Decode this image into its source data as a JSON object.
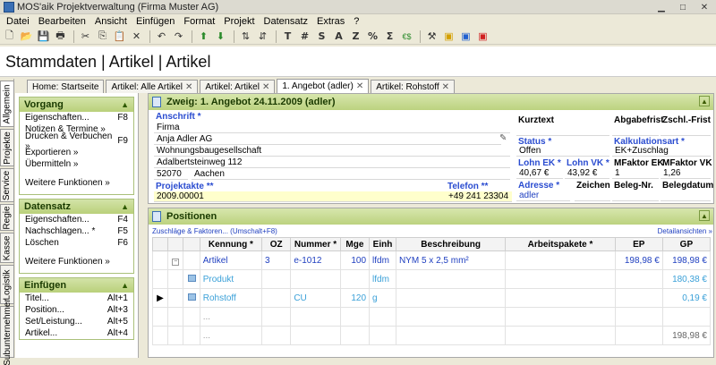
{
  "window": {
    "title": "MOS'aik Projektverwaltung (Firma Muster AG)",
    "controls": [
      "minimize",
      "maximize",
      "close"
    ]
  },
  "menu": [
    "Datei",
    "Bearbeiten",
    "Ansicht",
    "Einfügen",
    "Format",
    "Projekt",
    "Datensatz",
    "Extras",
    "?"
  ],
  "toolbar": {
    "new": "🗋",
    "open": "📂",
    "save": "💾",
    "print": "🖶",
    "cut": "✂",
    "copy": "⎘",
    "paste": "📋",
    "delete": "✕",
    "undo": "↶",
    "redo": "↷",
    "up": "⬆",
    "down": "⬇",
    "t": "T",
    "hash": "#",
    "s": "S",
    "a": "A",
    "z": "Z",
    "percent": "%",
    "sum": "Σ",
    "euro": "€$"
  },
  "page_title": "Stammdaten | Artikel | Artikel",
  "tabs": [
    {
      "label": "Home: Startseite",
      "close": false
    },
    {
      "label": "Artikel: Alle Artikel",
      "close": true
    },
    {
      "label": "Artikel: Artikel",
      "close": true
    },
    {
      "label": "1. Angebot (adler)",
      "close": true,
      "active": true
    },
    {
      "label": "Artikel: Rohstoff",
      "close": true
    }
  ],
  "close_glyph": "✕",
  "vertical_tabs": [
    "Allgemein",
    "Projekte",
    "Service",
    "Regie",
    "Kasse",
    "Logistik",
    "Subunternehmer"
  ],
  "sidebar": {
    "vorgang": {
      "title": "Vorgang",
      "items": [
        {
          "label": "Eigenschaften...",
          "key": "F8"
        },
        {
          "label": "Notizen & Termine »",
          "key": ""
        },
        {
          "label": "Drucken & Verbuchen »",
          "key": "F9"
        },
        {
          "label": "Exportieren »",
          "key": ""
        },
        {
          "label": "Übermitteln »",
          "key": ""
        }
      ],
      "more": "Weitere Funktionen »"
    },
    "datensatz": {
      "title": "Datensatz",
      "items": [
        {
          "label": "Eigenschaften...",
          "key": "F4"
        },
        {
          "label": "Nachschlagen... *",
          "key": "F5"
        },
        {
          "label": "Löschen",
          "key": "F6"
        }
      ],
      "more": "Weitere Funktionen »"
    },
    "einfuegen": {
      "title": "Einfügen",
      "items": [
        {
          "label": "Titel...",
          "key": "Alt+1"
        },
        {
          "label": "Position...",
          "key": "Alt+3"
        },
        {
          "label": "Set/Leistung...",
          "key": "Alt+5"
        },
        {
          "label": "Artikel...",
          "key": "Alt+4"
        }
      ]
    }
  },
  "header_box": {
    "title": "Zweig: 1. Angebot 24.11.2009 (adler)",
    "anschrift_label": "Anschrift *",
    "anschrift_lines": [
      "Firma",
      "Anja Adler AG",
      "Wohnungsbaugesellschaft",
      "Adalbertsteinweg 112"
    ],
    "plz": "52070",
    "ort": "Aachen",
    "projektakte_label": "Projektakte **",
    "projektakte": "2009.00001",
    "telefon_label": "Telefon **",
    "telefon": "+49 241 23304",
    "kurztext_label": "Kurztext",
    "status_label": "Status *",
    "status": "Offen",
    "lohn_ek_label": "Lohn EK *",
    "lohn_ek": "40,67 €",
    "lohn_vk_label": "Lohn VK *",
    "lohn_vk": "43,92 €",
    "adresse_label": "Adresse *",
    "adresse": "adler",
    "zeichen_label": "Zeichen",
    "abgabefrist_label": "Abgabefrist",
    "zschl_frist_label": "Zschl.-Frist",
    "kalkulationsart_label": "Kalkulationsart *",
    "kalkulationsart": "EK+Zuschlag",
    "mfaktor_ek_label": "MFaktor EK",
    "mfaktor_ek": "1",
    "mfaktor_vk_label": "MFaktor VK",
    "mfaktor_vk": "1,26",
    "beleg_nr_label": "Beleg-Nr.",
    "belegdatum_label": "Belegdatum"
  },
  "positions": {
    "title": "Positionen",
    "link_left": "Zuschläge & Faktoren... (Umschalt+F8)",
    "link_right": "Detailansichten »",
    "columns": [
      "Kennung *",
      "OZ",
      "Nummer *",
      "Mge",
      "Einh",
      "Beschreibung",
      "Arbeitspakete *",
      "EP",
      "GP"
    ],
    "rows": [
      {
        "kennung": "Artikel",
        "oz": "3",
        "nummer": "e-1012",
        "mge": "100",
        "einh": "lfdm",
        "beschreibung": "NYM 5 x 2,5 mm²",
        "ap": "",
        "ep": "198,98 €",
        "gp": "198,98 €",
        "style": "blue"
      },
      {
        "kennung": "Produkt",
        "oz": "",
        "nummer": "",
        "mge": "",
        "einh": "lfdm",
        "beschreibung": "",
        "ap": "",
        "ep": "",
        "gp": "180,38 €",
        "style": "light"
      },
      {
        "kennung": "Rohstoff",
        "oz": "",
        "nummer": "CU",
        "mge": "120",
        "einh": "g",
        "beschreibung": "",
        "ap": "",
        "ep": "",
        "gp": "0,19 €",
        "style": "light"
      },
      {
        "kennung": "...",
        "oz": "",
        "nummer": "",
        "mge": "",
        "einh": "",
        "beschreibung": "",
        "ap": "",
        "ep": "",
        "gp": "",
        "style": "light"
      },
      {
        "kennung": "...",
        "oz": "",
        "nummer": "",
        "mge": "",
        "einh": "",
        "beschreibung": "",
        "ap": "",
        "ep": "",
        "gp": "198,98 €",
        "style": "plain"
      }
    ]
  }
}
